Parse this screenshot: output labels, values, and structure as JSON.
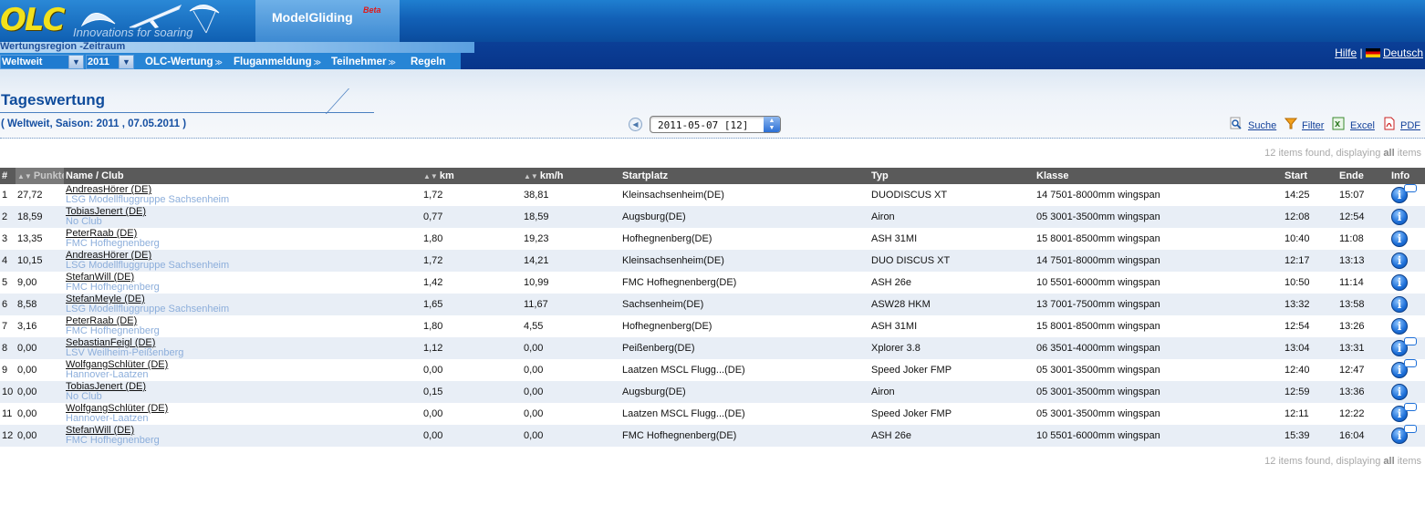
{
  "header": {
    "logo_text": "OLC",
    "logo_tagline": "Innovations for soaring",
    "active_tab": "ModelGliding",
    "active_tab_badge": "Beta"
  },
  "region_bar": {
    "label": "Wertungsregion -Zeitraum",
    "region_value": "Weltweit",
    "year_value": "2011"
  },
  "nav": {
    "items": [
      "OLC-Wertung",
      "Fluganmeldung",
      "Teilnehmer",
      "Regeln"
    ],
    "help_label": "Hilfe",
    "separator": "|",
    "language_label": "Deutsch"
  },
  "page": {
    "title": "Tageswertung",
    "subtitle": "( Weltweit, Saison: 2011 , 07.05.2011 )",
    "date_value": "2011-05-07 [12]",
    "tools": [
      "Suche",
      "Filter",
      "Excel",
      "PDF"
    ],
    "count_text_prefix": "12 items found, displaying",
    "count_text_bold": "all",
    "count_text_suffix": "items"
  },
  "table": {
    "columns": [
      "#",
      "Punkte",
      "Name / Club",
      "km",
      "km/h",
      "Startplatz",
      "Typ",
      "Klasse",
      "Start",
      "Ende",
      "Info"
    ],
    "rows": [
      {
        "rank": "1",
        "points": "27,72",
        "pilot": "AndreasHörer (DE)",
        "club": "LSG Modellfluggruppe Sachsenheim",
        "km": "1,72",
        "kmh": "38,81",
        "start_place": "Kleinsachsenheim(DE)",
        "type": "DUODISCUS XT",
        "class": "14 7501-8000mm wingspan",
        "start": "14:25",
        "end": "15:07",
        "comment": true
      },
      {
        "rank": "2",
        "points": "18,59",
        "pilot": "TobiasJenert (DE)",
        "club": "No Club",
        "km": "0,77",
        "kmh": "18,59",
        "start_place": "Augsburg(DE)",
        "type": "Airon",
        "class": "05 3001-3500mm wingspan",
        "start": "12:08",
        "end": "12:54",
        "comment": false
      },
      {
        "rank": "3",
        "points": "13,35",
        "pilot": "PeterRaab (DE)",
        "club": "FMC Hofhegnenberg",
        "km": "1,80",
        "kmh": "19,23",
        "start_place": "Hofhegnenberg(DE)",
        "type": "ASH 31MI",
        "class": "15 8001-8500mm wingspan",
        "start": "10:40",
        "end": "11:08",
        "comment": false
      },
      {
        "rank": "4",
        "points": "10,15",
        "pilot": "AndreasHörer (DE)",
        "club": "LSG Modellfluggruppe Sachsenheim",
        "km": "1,72",
        "kmh": "14,21",
        "start_place": "Kleinsachsenheim(DE)",
        "type": "DUO DISCUS XT",
        "class": "14 7501-8000mm wingspan",
        "start": "12:17",
        "end": "13:13",
        "comment": false
      },
      {
        "rank": "5",
        "points": "9,00",
        "pilot": "StefanWill (DE)",
        "club": "FMC Hofhegnenberg",
        "km": "1,42",
        "kmh": "10,99",
        "start_place": "FMC Hofhegnenberg(DE)",
        "type": "ASH 26e",
        "class": "10 5501-6000mm wingspan",
        "start": "10:50",
        "end": "11:14",
        "comment": false
      },
      {
        "rank": "6",
        "points": "8,58",
        "pilot": "StefanMeyle (DE)",
        "club": "LSG Modellfluggruppe Sachsenheim",
        "km": "1,65",
        "kmh": "11,67",
        "start_place": "Sachsenheim(DE)",
        "type": "ASW28 HKM",
        "class": "13 7001-7500mm wingspan",
        "start": "13:32",
        "end": "13:58",
        "comment": false
      },
      {
        "rank": "7",
        "points": "3,16",
        "pilot": "PeterRaab (DE)",
        "club": "FMC Hofhegnenberg",
        "km": "1,80",
        "kmh": "4,55",
        "start_place": "Hofhegnenberg(DE)",
        "type": "ASH 31MI",
        "class": "15 8001-8500mm wingspan",
        "start": "12:54",
        "end": "13:26",
        "comment": false
      },
      {
        "rank": "8",
        "points": "0,00",
        "pilot": "SebastianFeigl (DE)",
        "club": "LSV Weilheim-Peißenberg",
        "km": "1,12",
        "kmh": "0,00",
        "start_place": "Peißenberg(DE)",
        "type": "Xplorer 3.8",
        "class": "06 3501-4000mm wingspan",
        "start": "13:04",
        "end": "13:31",
        "comment": true
      },
      {
        "rank": "9",
        "points": "0,00",
        "pilot": "WolfgangSchlüter (DE)",
        "club": "Hannover-Laatzen",
        "km": "0,00",
        "kmh": "0,00",
        "start_place": "Laatzen MSCL Flugg...(DE)",
        "type": "Speed Joker FMP",
        "class": "05 3001-3500mm wingspan",
        "start": "12:40",
        "end": "12:47",
        "comment": true
      },
      {
        "rank": "10",
        "points": "0,00",
        "pilot": "TobiasJenert (DE)",
        "club": "No Club",
        "km": "0,15",
        "kmh": "0,00",
        "start_place": "Augsburg(DE)",
        "type": "Airon",
        "class": "05 3001-3500mm wingspan",
        "start": "12:59",
        "end": "13:36",
        "comment": false
      },
      {
        "rank": "11",
        "points": "0,00",
        "pilot": "WolfgangSchlüter (DE)",
        "club": "Hannover-Laatzen",
        "km": "0,00",
        "kmh": "0,00",
        "start_place": "Laatzen MSCL Flugg...(DE)",
        "type": "Speed Joker FMP",
        "class": "05 3001-3500mm wingspan",
        "start": "12:11",
        "end": "12:22",
        "comment": true
      },
      {
        "rank": "12",
        "points": "0,00",
        "pilot": "StefanWill (DE)",
        "club": "FMC Hofhegnenberg",
        "km": "0,00",
        "kmh": "0,00",
        "start_place": "FMC Hofhegnenberg(DE)",
        "type": "ASH 26e",
        "class": "10 5501-6000mm wingspan",
        "start": "15:39",
        "end": "16:04",
        "comment": true
      }
    ]
  },
  "colors": {
    "header_blue": "#1260b6",
    "nav_dark": "#0a3a8e",
    "title_text": "#0f4c9c",
    "club_text": "#8caedb",
    "table_header": "#5a5a5a",
    "row_alt": "#e8eef6",
    "logo_yellow": "#f2e11c",
    "beta_red": "#e01818"
  },
  "icons": {
    "search": "magnifier-icon",
    "filter": "filter-funnel-icon",
    "excel": "excel-file-icon",
    "pdf": "pdf-file-icon",
    "info": "info-icon",
    "comment": "comment-bubble-icon",
    "language": "german-flag-icon",
    "date_prev": "previous-day-icon"
  }
}
